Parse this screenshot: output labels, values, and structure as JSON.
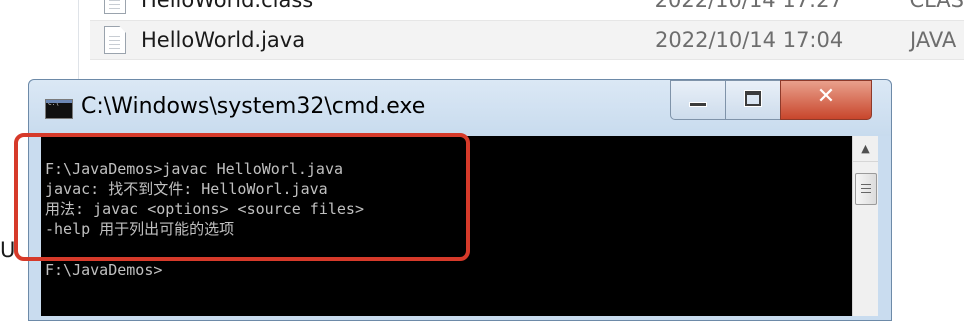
{
  "explorer": {
    "files": [
      {
        "name": "HelloWorld.class",
        "date": "2022/10/14 17:27",
        "type": "CLAS"
      },
      {
        "name": "HelloWorld.java",
        "date": "2022/10/14 17:04",
        "type": "JAVA"
      }
    ],
    "stray_text": "U"
  },
  "cmd": {
    "title": "C:\\Windows\\system32\\cmd.exe",
    "close_label": "✕",
    "lines": [
      "F:\\JavaDemos>javac HelloWorl.java",
      "javac: 找不到文件: HelloWorl.java",
      "用法: javac <options> <source files>",
      "-help 用于列出可能的选项",
      "F:\\JavaDemos>"
    ],
    "scroll_up_glyph": "▲"
  },
  "colors": {
    "console_bg": "#000000",
    "console_text": "#c0c0c0",
    "highlight": "#d63a2a",
    "close_button": "#c8462c"
  }
}
